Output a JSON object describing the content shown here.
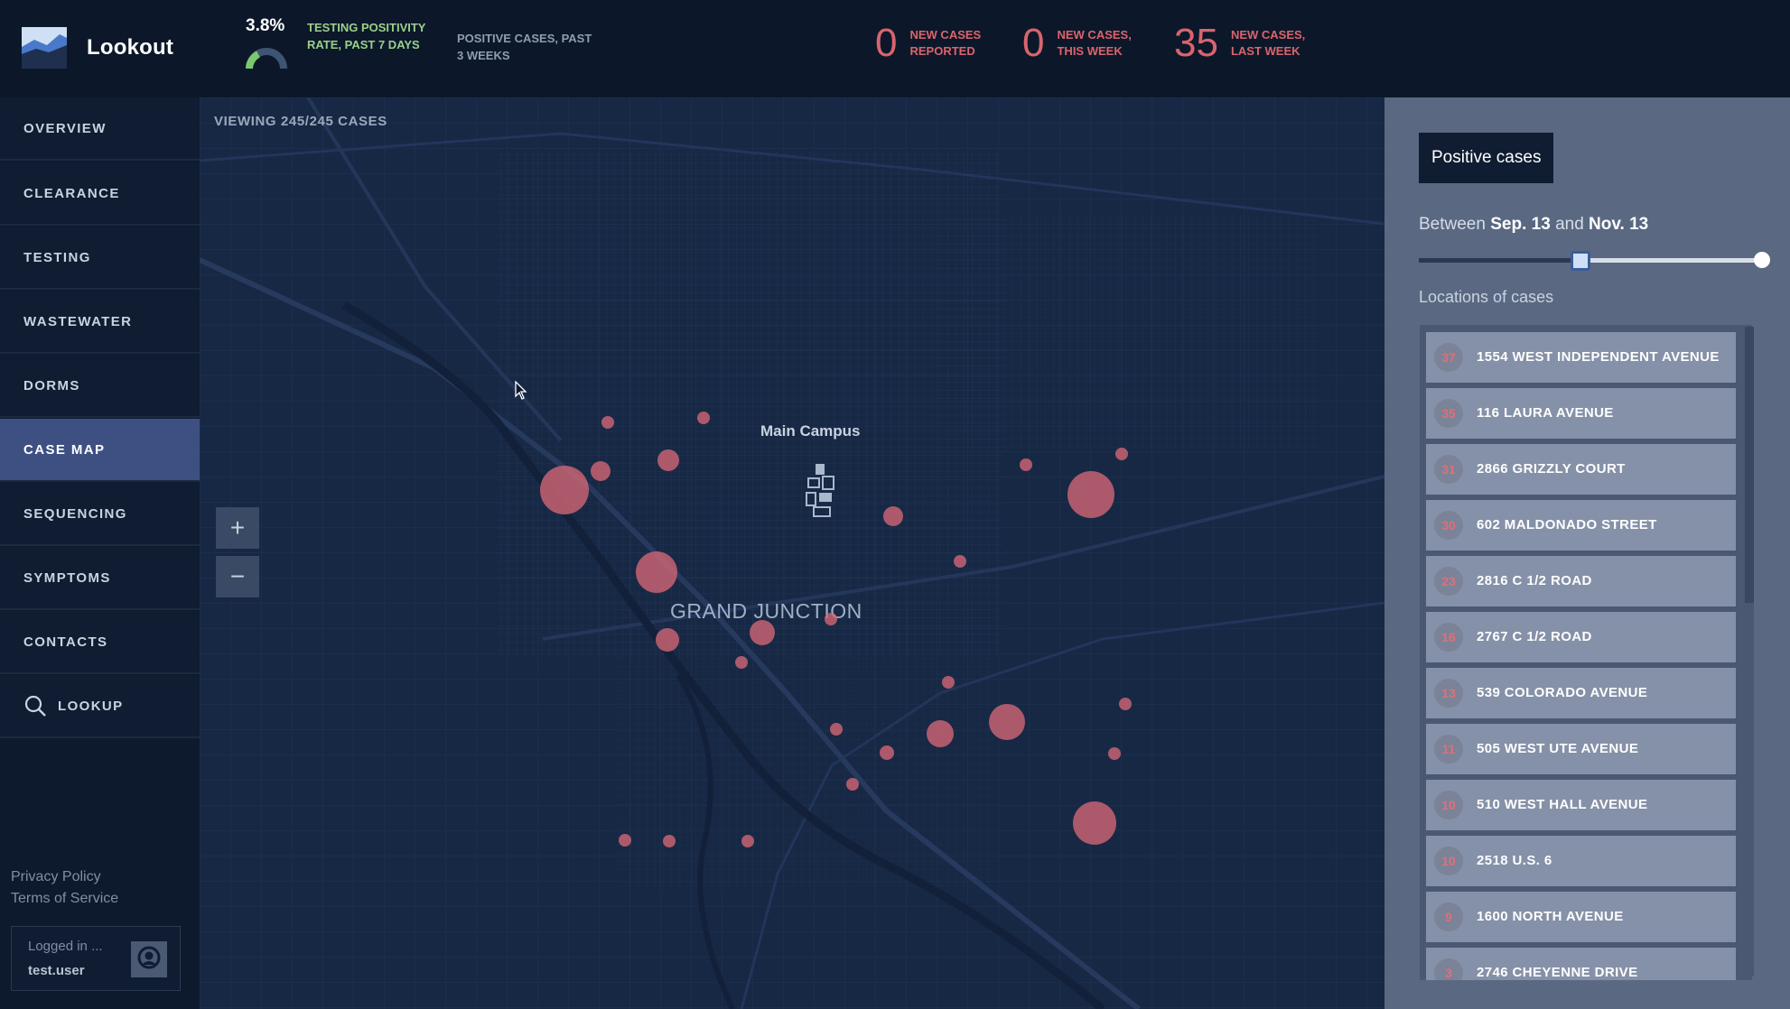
{
  "app": {
    "name": "Lookout"
  },
  "header": {
    "positivity_rate": "3.8%",
    "positivity_label": "TESTING POSITIVITY RATE, PAST 7 DAYS",
    "positive_cases_label": "POSITIVE CASES, PAST 3 WEEKS",
    "kpis": [
      {
        "value": "0",
        "label": "NEW CASES REPORTED"
      },
      {
        "value": "0",
        "label": "NEW CASES, THIS WEEK"
      },
      {
        "value": "35",
        "label": "NEW CASES, LAST WEEK"
      }
    ]
  },
  "sidebar": {
    "items": [
      {
        "label": "OVERVIEW"
      },
      {
        "label": "CLEARANCE"
      },
      {
        "label": "TESTING"
      },
      {
        "label": "WASTEWATER"
      },
      {
        "label": "DORMS"
      },
      {
        "label": "CASE MAP"
      },
      {
        "label": "SEQUENCING"
      },
      {
        "label": "SYMPTOMS"
      },
      {
        "label": "CONTACTS"
      },
      {
        "label": "LOOKUP"
      }
    ],
    "active": "CASE MAP",
    "privacy": "Privacy Policy",
    "terms": "Terms of Service",
    "logged_in": "Logged in ...",
    "username": "test.user"
  },
  "map": {
    "viewing": "VIEWING 245/245 CASES",
    "campus_label": "Main Campus",
    "city_label": "GRAND JUNCTION",
    "zoom_in": "+",
    "zoom_out": "−"
  },
  "panel": {
    "title": "Positive cases",
    "between_prefix": "Between",
    "start_date": "Sep. 13",
    "and": "and",
    "end_date": "Nov. 13",
    "slider_start_fraction": 0.47,
    "slider_end_fraction": 1.0,
    "locations_heading": "Locations of cases",
    "locations": [
      {
        "count": "37",
        "address": "1554 WEST INDEPENDENT AVENUE"
      },
      {
        "count": "35",
        "address": "116 LAURA AVENUE"
      },
      {
        "count": "31",
        "address": "2866 GRIZZLY COURT"
      },
      {
        "count": "30",
        "address": "602 MALDONADO STREET"
      },
      {
        "count": "23",
        "address": "2816 C 1/2 ROAD"
      },
      {
        "count": "16",
        "address": "2767 C 1/2 ROAD"
      },
      {
        "count": "13",
        "address": "539 COLORADO AVENUE"
      },
      {
        "count": "11",
        "address": "505 WEST UTE AVENUE"
      },
      {
        "count": "10",
        "address": "510 WEST HALL AVENUE"
      },
      {
        "count": "10",
        "address": "2518 U.S. 6"
      },
      {
        "count": "9",
        "address": "1600 NORTH AVENUE"
      },
      {
        "count": "3",
        "address": "2746 CHEYENNE DRIVE"
      }
    ]
  },
  "colors": {
    "accent_red": "#d9646e",
    "positivity_green": "#9ad08b",
    "active_nav": "#3e5082"
  }
}
